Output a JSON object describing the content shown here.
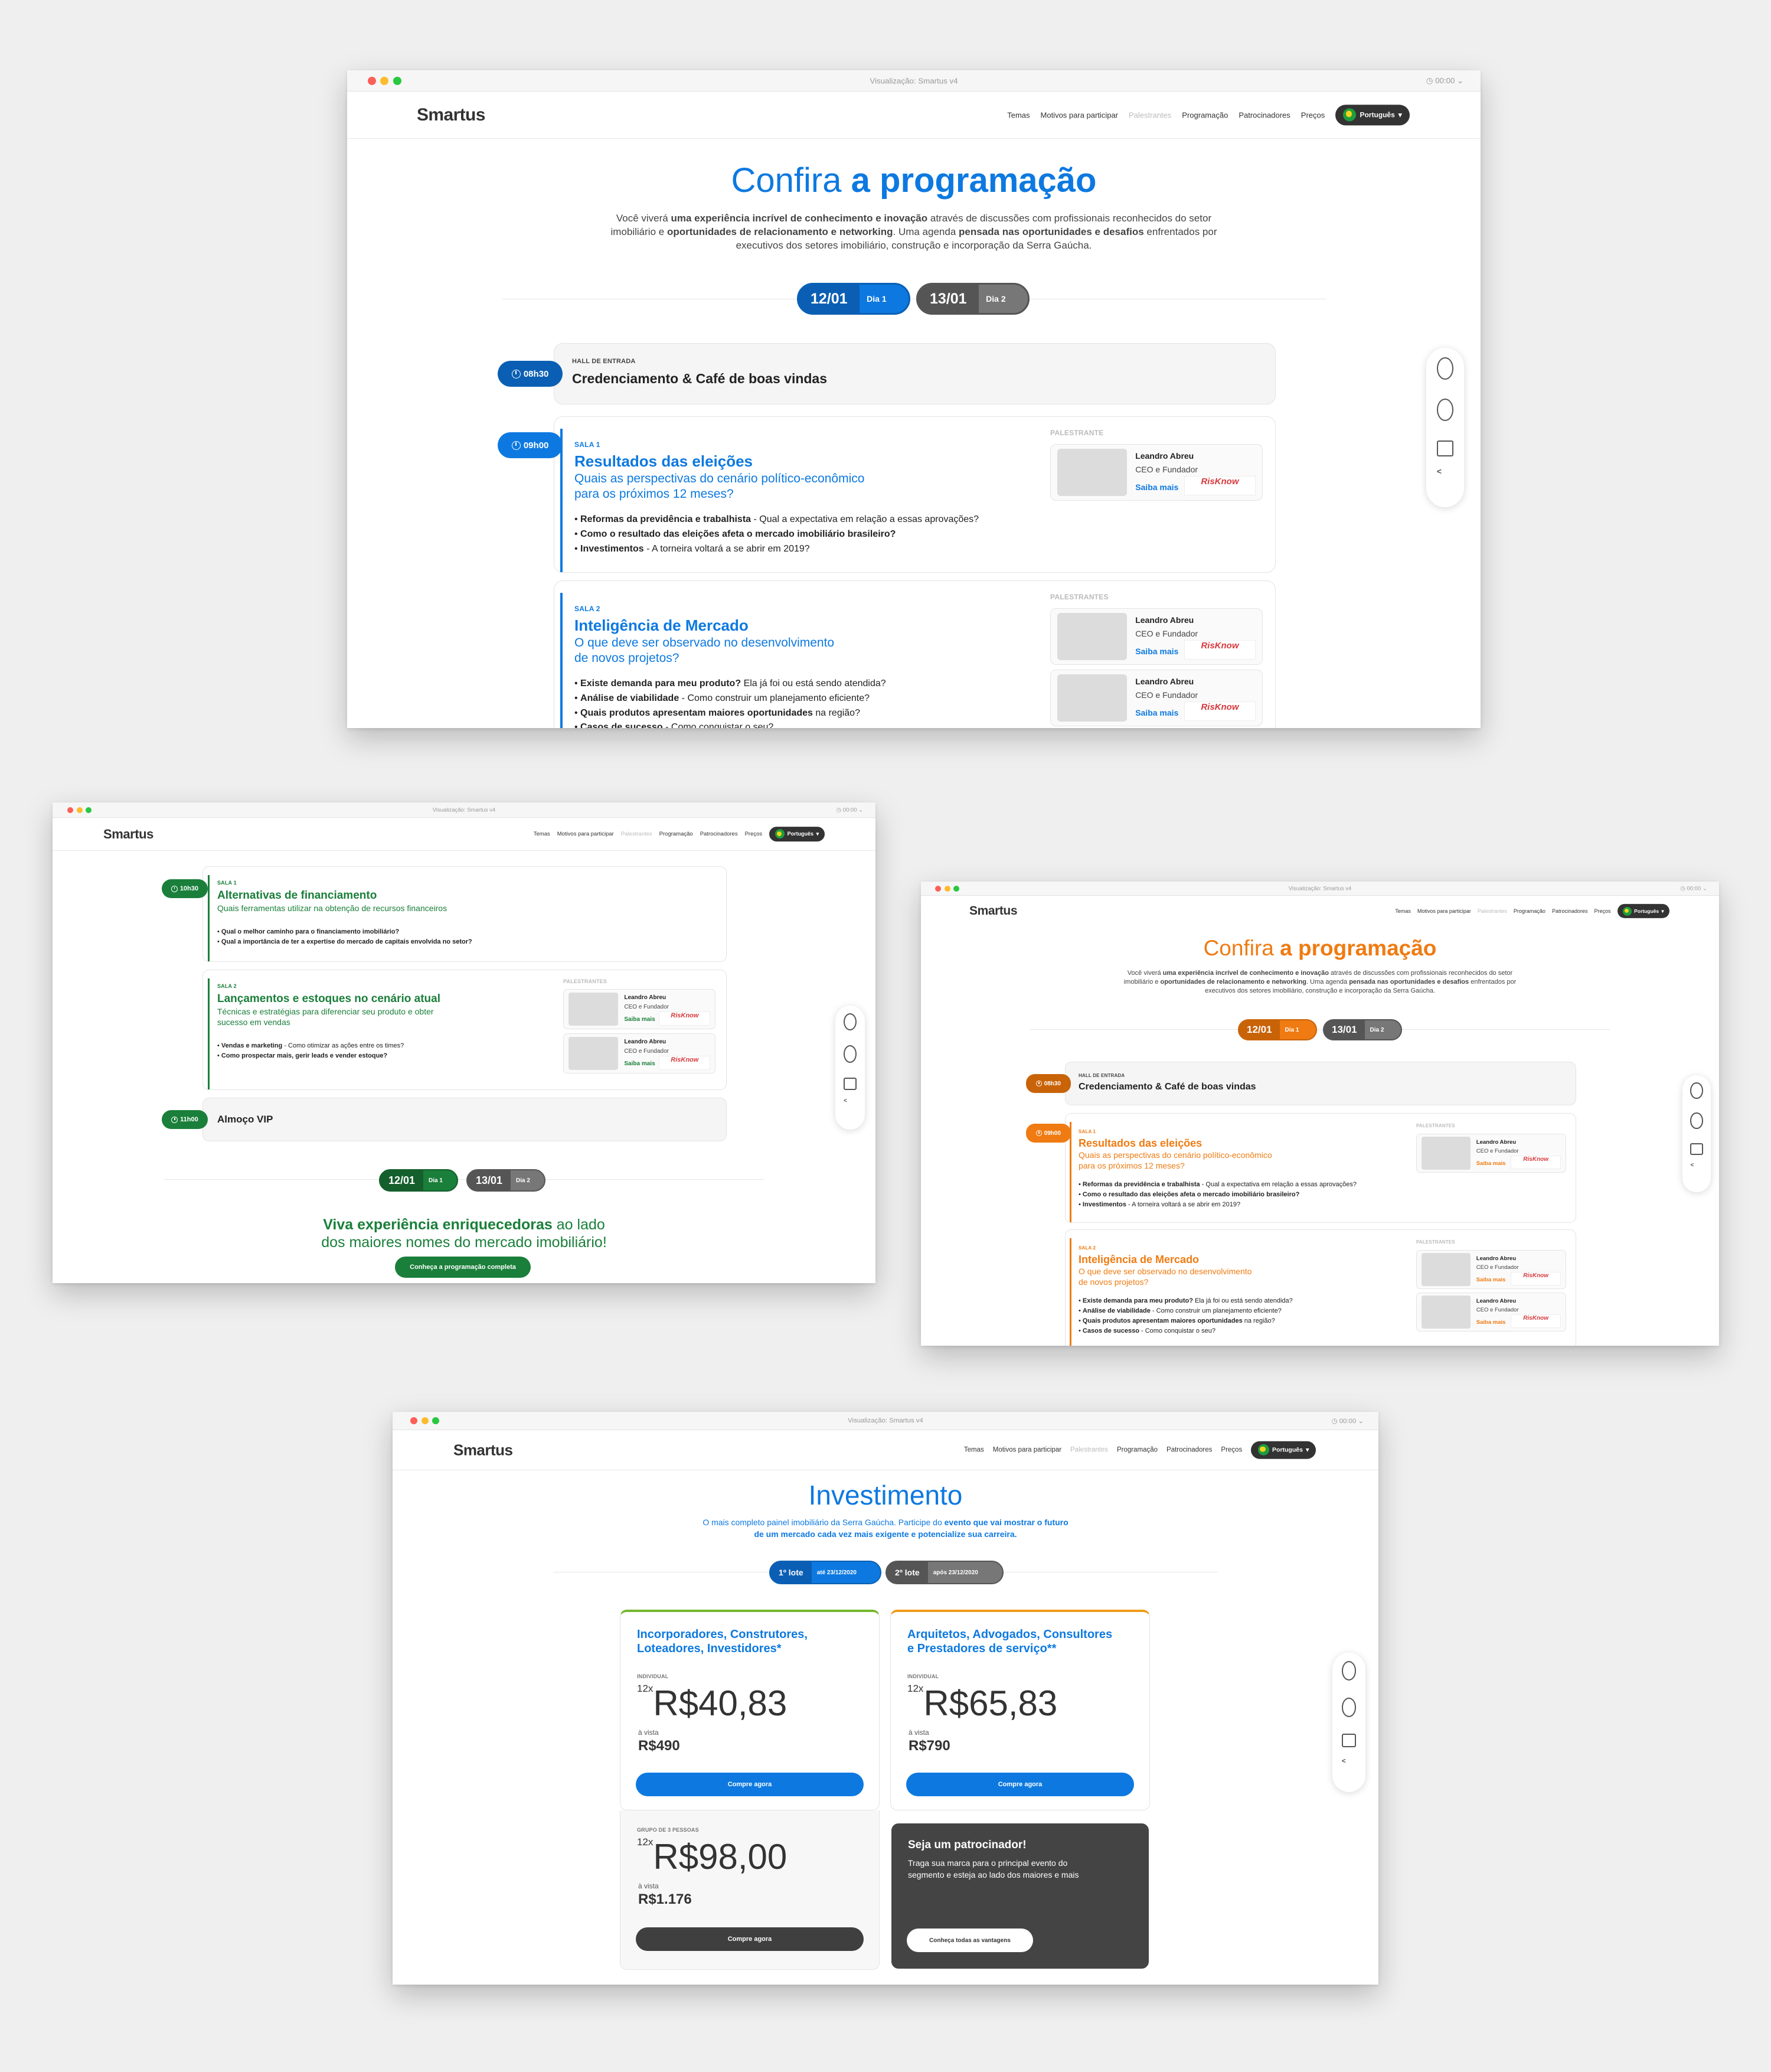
{
  "window": {
    "title": "Visualização: Smartus v4",
    "time": "00:00"
  },
  "nav": {
    "logo": "Smartus",
    "items": [
      "Temas",
      "Motivos para participar",
      "Palestrantes",
      "Programação",
      "Patrocinadores",
      "Preços"
    ],
    "language": "Português"
  },
  "colors": {
    "blue": "#0d79e0",
    "green": "#1a7f3a",
    "orange": "#ef7b12",
    "grey": "#555555"
  },
  "icons": [
    "whatsapp-icon",
    "phone-icon",
    "mail-icon",
    "share-icon",
    "clock-icon"
  ],
  "prog": {
    "title_light": "Confira",
    "title_bold": "a programação",
    "intro_a": "Você viverá",
    "intro_b": "uma experiência incrível de conhecimento e inovação",
    "intro_c": "através de discussões com profissionais reconhecidos do setor",
    "intro_d": "imobiliário e",
    "intro_e": "oportunidades de relacionamento e networking",
    "intro_f": ". Uma agenda",
    "intro_g": "pensada nas oportunidades e desafios",
    "intro_h": "enfrentados por",
    "intro_i": "executivos dos setores imobiliário, construção e incorporação da Serra Gaúcha.",
    "day1_date": "12/01",
    "day1_label": "Dia 1",
    "day2_date": "13/01",
    "day2_label": "Dia 2",
    "hall_time": "08h30",
    "hall_label": "HALL DE ENTRADA",
    "hall_title": "Credenciamento & Café de boas vindas",
    "s1_time": "09h00",
    "s1_room": "SALA 1",
    "s1_title": "Resultados das eleições",
    "s1_sub1": "Quais as perspectivas do cenário político-econômico",
    "s1_sub2": "para os próximos 12 meses?",
    "s1_b1a": "Reformas da previdência e trabalhista",
    "s1_b1b": "- Qual a expectativa em relação a essas aprovações?",
    "s1_b2a": "Como o resultado das eleições afeta o mercado imobiliário brasileiro?",
    "s1_b3a": "Investimentos",
    "s1_b3b": "- A torneira voltará a se abrir em 2019?",
    "speaker_label": "PALESTRANTE",
    "speakers_label": "PALESTRANTES",
    "spk_name": "Leandro Abreu",
    "spk_role": "CEO e Fundador",
    "spk_more": "Saiba mais",
    "spk_logo": "RisKnow",
    "spk_logo_sub": "Know Your Risk Now",
    "s2_room": "SALA 2",
    "s2_title": "Inteligência de Mercado",
    "s2_sub1": "O que deve ser observado no desenvolvimento",
    "s2_sub2": "de novos projetos?",
    "s2_b1a": "Existe demanda para meu produto?",
    "s2_b1b": "Ela já foi ou está sendo atendida?",
    "s2_b2a": "Análise de viabilidade",
    "s2_b2b": "- Como construir um planejamento eficiente?",
    "s2_b3a": "Quais produtos apresentam maiores oportunidades",
    "s2_b3b": "na região?",
    "s2_b4a": "Casos de sucesso",
    "s2_b4b": "- Como conquistar o seu?"
  },
  "green": {
    "t1_time": "10h30",
    "t1_room": "SALA 1",
    "t1_title": "Alternativas de financiamento",
    "t1_sub": "Quais ferramentas utilizar na obtenção de recursos financeiros",
    "t1_b1": "Qual o melhor caminho para o financiamento imobiliário?",
    "t1_b2": "Qual a importância de ter a expertise do mercado de capitais envolvida no setor?",
    "t2_room": "SALA 2",
    "t2_title": "Lançamentos e estoques no cenário atual",
    "t2_sub1": "Técnicas e estratégias para diferenciar seu produto e obter",
    "t2_sub2": "sucesso em vendas",
    "t2_b1a": "Vendas e marketing",
    "t2_b1b": "- Como otimizar as ações entre os times?",
    "t2_b2": "Como prospectar mais, gerir leads e vender estoque?",
    "lunch_time": "11h00",
    "lunch_title": "Almoço VIP",
    "cta_bold": "Viva experiência enriquecedoras",
    "cta_light1": "ao lado",
    "cta_light2": "dos maiores nomes do mercado imobiliário!",
    "cta_button": "Conheça a programação completa"
  },
  "invest": {
    "title": "Investimento",
    "sub1a": "O mais completo painel imobiliário da Serra Gaúcha. Participe do",
    "sub1b": "evento que vai mostrar o futuro",
    "sub2a": "de um mercado cada vez mais exigente e",
    "sub2b": "potencialize sua carreira.",
    "lot1": "1º lote",
    "lot1_date": "até 23/12/2020",
    "lot2": "2º lote",
    "lot2_date": "após 23/12/2020",
    "c1_title1": "Incorporadores, Construtores,",
    "c1_title2": "Loteadores, Investidores*",
    "individual": "INDIVIDUAL",
    "installments": "12x",
    "c1_price": "R$40,83",
    "cash_label": "à vista",
    "c1_cash": "R$490",
    "buy": "Compre agora",
    "c2_title1": "Arquitetos, Advogados, Consultores",
    "c2_title2": "e Prestadores de serviço**",
    "c2_price": "R$65,83",
    "c2_cash": "R$790",
    "group_label": "GRUPO DE 3 PESSOAS",
    "g_price": "R$98,00",
    "g_cash": "R$1.176",
    "sp_title": "Seja um patrocinador!",
    "sp_text1": "Traga sua marca para o principal evento do",
    "sp_text2": "segmento e esteja ao lado dos maiores e mais",
    "sp_button": "Conheça todas as vantagens"
  }
}
